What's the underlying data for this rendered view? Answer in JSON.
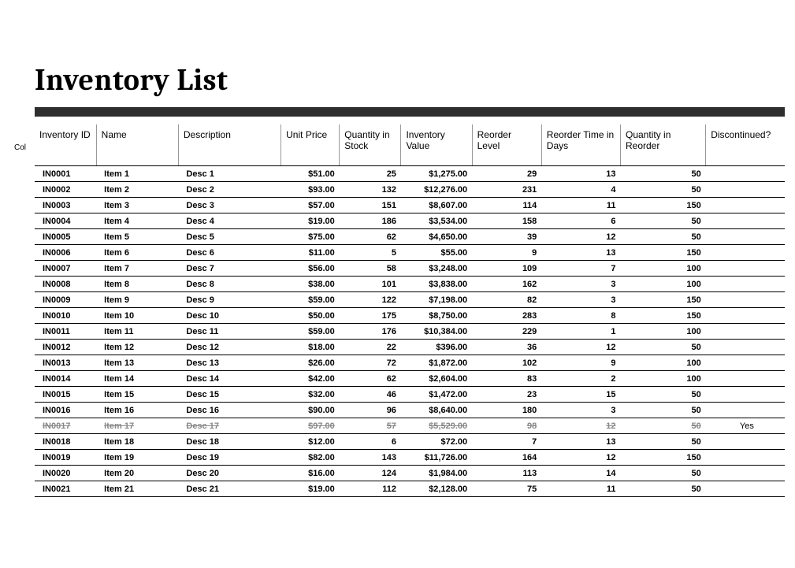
{
  "title": "Inventory List",
  "side_label": "Col",
  "columns": [
    "Inventory ID",
    "Name",
    "Description",
    "Unit Price",
    "Quantity in Stock",
    "Inventory Value",
    "Reorder Level",
    "Reorder Time in Days",
    "Quantity in Reorder",
    "Discontinued?"
  ],
  "rows": [
    {
      "id": "IN0001",
      "name": "Item 1",
      "desc": "Desc 1",
      "price": "$51.00",
      "qty": "25",
      "value": "$1,275.00",
      "rlvl": "29",
      "rtime": "13",
      "rqty": "50",
      "disc": "",
      "discontinued": false
    },
    {
      "id": "IN0002",
      "name": "Item 2",
      "desc": "Desc 2",
      "price": "$93.00",
      "qty": "132",
      "value": "$12,276.00",
      "rlvl": "231",
      "rtime": "4",
      "rqty": "50",
      "disc": "",
      "discontinued": false
    },
    {
      "id": "IN0003",
      "name": "Item 3",
      "desc": "Desc 3",
      "price": "$57.00",
      "qty": "151",
      "value": "$8,607.00",
      "rlvl": "114",
      "rtime": "11",
      "rqty": "150",
      "disc": "",
      "discontinued": false
    },
    {
      "id": "IN0004",
      "name": "Item 4",
      "desc": "Desc 4",
      "price": "$19.00",
      "qty": "186",
      "value": "$3,534.00",
      "rlvl": "158",
      "rtime": "6",
      "rqty": "50",
      "disc": "",
      "discontinued": false
    },
    {
      "id": "IN0005",
      "name": "Item 5",
      "desc": "Desc 5",
      "price": "$75.00",
      "qty": "62",
      "value": "$4,650.00",
      "rlvl": "39",
      "rtime": "12",
      "rqty": "50",
      "disc": "",
      "discontinued": false
    },
    {
      "id": "IN0006",
      "name": "Item 6",
      "desc": "Desc 6",
      "price": "$11.00",
      "qty": "5",
      "value": "$55.00",
      "rlvl": "9",
      "rtime": "13",
      "rqty": "150",
      "disc": "",
      "discontinued": false
    },
    {
      "id": "IN0007",
      "name": "Item 7",
      "desc": "Desc 7",
      "price": "$56.00",
      "qty": "58",
      "value": "$3,248.00",
      "rlvl": "109",
      "rtime": "7",
      "rqty": "100",
      "disc": "",
      "discontinued": false
    },
    {
      "id": "IN0008",
      "name": "Item 8",
      "desc": "Desc 8",
      "price": "$38.00",
      "qty": "101",
      "value": "$3,838.00",
      "rlvl": "162",
      "rtime": "3",
      "rqty": "100",
      "disc": "",
      "discontinued": false
    },
    {
      "id": "IN0009",
      "name": "Item 9",
      "desc": "Desc 9",
      "price": "$59.00",
      "qty": "122",
      "value": "$7,198.00",
      "rlvl": "82",
      "rtime": "3",
      "rqty": "150",
      "disc": "",
      "discontinued": false
    },
    {
      "id": "IN0010",
      "name": "Item 10",
      "desc": "Desc 10",
      "price": "$50.00",
      "qty": "175",
      "value": "$8,750.00",
      "rlvl": "283",
      "rtime": "8",
      "rqty": "150",
      "disc": "",
      "discontinued": false
    },
    {
      "id": "IN0011",
      "name": "Item 11",
      "desc": "Desc 11",
      "price": "$59.00",
      "qty": "176",
      "value": "$10,384.00",
      "rlvl": "229",
      "rtime": "1",
      "rqty": "100",
      "disc": "",
      "discontinued": false
    },
    {
      "id": "IN0012",
      "name": "Item 12",
      "desc": "Desc 12",
      "price": "$18.00",
      "qty": "22",
      "value": "$396.00",
      "rlvl": "36",
      "rtime": "12",
      "rqty": "50",
      "disc": "",
      "discontinued": false
    },
    {
      "id": "IN0013",
      "name": "Item 13",
      "desc": "Desc 13",
      "price": "$26.00",
      "qty": "72",
      "value": "$1,872.00",
      "rlvl": "102",
      "rtime": "9",
      "rqty": "100",
      "disc": "",
      "discontinued": false
    },
    {
      "id": "IN0014",
      "name": "Item 14",
      "desc": "Desc 14",
      "price": "$42.00",
      "qty": "62",
      "value": "$2,604.00",
      "rlvl": "83",
      "rtime": "2",
      "rqty": "100",
      "disc": "",
      "discontinued": false
    },
    {
      "id": "IN0015",
      "name": "Item 15",
      "desc": "Desc 15",
      "price": "$32.00",
      "qty": "46",
      "value": "$1,472.00",
      "rlvl": "23",
      "rtime": "15",
      "rqty": "50",
      "disc": "",
      "discontinued": false
    },
    {
      "id": "IN0016",
      "name": "Item 16",
      "desc": "Desc 16",
      "price": "$90.00",
      "qty": "96",
      "value": "$8,640.00",
      "rlvl": "180",
      "rtime": "3",
      "rqty": "50",
      "disc": "",
      "discontinued": false
    },
    {
      "id": "IN0017",
      "name": "Item 17",
      "desc": "Desc 17",
      "price": "$97.00",
      "qty": "57",
      "value": "$5,529.00",
      "rlvl": "98",
      "rtime": "12",
      "rqty": "50",
      "disc": "Yes",
      "discontinued": true
    },
    {
      "id": "IN0018",
      "name": "Item 18",
      "desc": "Desc 18",
      "price": "$12.00",
      "qty": "6",
      "value": "$72.00",
      "rlvl": "7",
      "rtime": "13",
      "rqty": "50",
      "disc": "",
      "discontinued": false
    },
    {
      "id": "IN0019",
      "name": "Item 19",
      "desc": "Desc 19",
      "price": "$82.00",
      "qty": "143",
      "value": "$11,726.00",
      "rlvl": "164",
      "rtime": "12",
      "rqty": "150",
      "disc": "",
      "discontinued": false
    },
    {
      "id": "IN0020",
      "name": "Item 20",
      "desc": "Desc 20",
      "price": "$16.00",
      "qty": "124",
      "value": "$1,984.00",
      "rlvl": "113",
      "rtime": "14",
      "rqty": "50",
      "disc": "",
      "discontinued": false
    },
    {
      "id": "IN0021",
      "name": "Item 21",
      "desc": "Desc 21",
      "price": "$19.00",
      "qty": "112",
      "value": "$2,128.00",
      "rlvl": "75",
      "rtime": "11",
      "rqty": "50",
      "disc": "",
      "discontinued": false
    }
  ]
}
